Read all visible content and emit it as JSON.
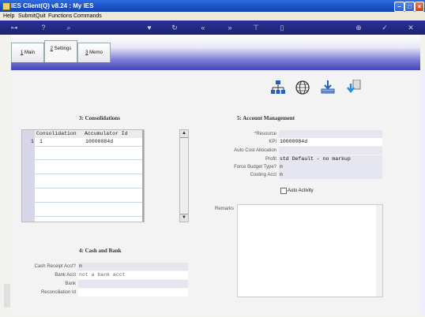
{
  "window": {
    "title": "IES Client(Q) v8.24 : My IES"
  },
  "menu": [
    "Help",
    "Submit",
    "Quit",
    "Functions",
    "Commands"
  ],
  "toolbar_icons": [
    "key-icon",
    "help-icon",
    "search-icon",
    "favorite-icon",
    "refresh-icon",
    "first-icon",
    "last-icon",
    "filter-icon",
    "document-icon",
    "save-icon",
    "ok-icon",
    "cancel-icon"
  ],
  "tabs": [
    {
      "num": "1",
      "label": "Main"
    },
    {
      "num": "2",
      "label": "Settings"
    },
    {
      "num": "3",
      "label": "Memo"
    }
  ],
  "consolidations": {
    "title": "3: Consolidations",
    "columns": [
      "Consolidation",
      "Accumulator Id"
    ],
    "rows": [
      {
        "n": "1",
        "consolidation": "1",
        "accumulator": "10000084d"
      }
    ]
  },
  "account_management": {
    "title": "5: Account Management",
    "resource_label": "*Resource",
    "kpi_label": "KPI",
    "kpi_value": "10000084d",
    "auto_cost_label": "Auto Cost Allocation",
    "profit_label": "Profit",
    "profit_value": "std Default - no markup",
    "force_budget_label": "Force Budget Type?",
    "force_budget_value": "n",
    "costing_acct_label": "Costing Acct",
    "costing_acct_value": "n",
    "auto_activity_label": "Auto Activity",
    "remarks_label": "Remarks"
  },
  "cash_bank": {
    "title": "4: Cash and Bank",
    "cash_receipt_label": "Cash Receipt Acct?",
    "cash_receipt_value": "n",
    "bank_acct_label": "Bank Acct",
    "bank_acct_value": "not a bank acct",
    "bank_label": "Bank",
    "recon_label": "Reconciliation Id"
  }
}
